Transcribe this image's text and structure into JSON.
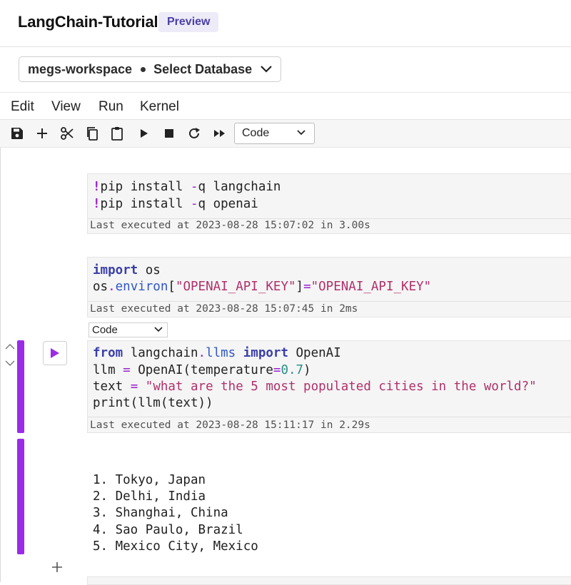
{
  "header": {
    "title": "LangChain-Tutorial",
    "badge": "Preview",
    "workspace": "megs-workspace",
    "database_select": "Select Database"
  },
  "menu": [
    "Edit",
    "View",
    "Run",
    "Kernel"
  ],
  "toolbar": {
    "icons": [
      "save-icon",
      "add-cell-icon",
      "cut-icon",
      "copy-icon",
      "paste-icon",
      "run-icon",
      "stop-icon",
      "restart-icon",
      "run-all-icon"
    ],
    "cell_type": "Code"
  },
  "cells": [
    {
      "code": [
        "!pip install -q langchain",
        "!pip install -q openai"
      ],
      "exec_info": "Last executed at 2023-08-28 15:07:02 in 3.00s"
    },
    {
      "code": [
        "import os",
        "os.environ[\"OPENAI_API_KEY\"]=\"OPENAI_API_KEY\""
      ],
      "exec_info": "Last executed at 2023-08-28 15:07:45 in 2ms"
    },
    {
      "cell_type": "Code",
      "code": [
        "from langchain.llms import OpenAI",
        "llm = OpenAI(temperature=0.7)",
        "text = \"what are the 5 most populated cities in the world?\"",
        "print(llm(text))"
      ],
      "exec_info": "Last executed at 2023-08-28 15:11:17 in 2.29s"
    }
  ],
  "output": {
    "lines": [
      "1. Tokyo, Japan",
      "2. Delhi, India",
      "3. Shanghai, China",
      "4. Sao Paulo, Brazil",
      "5. Mexico City, Mexico"
    ]
  },
  "colors": {
    "accent": "#9a2be6",
    "badge_text": "#4b3fa6",
    "keyword": "#3a3fa8",
    "string": "#b0306a"
  }
}
